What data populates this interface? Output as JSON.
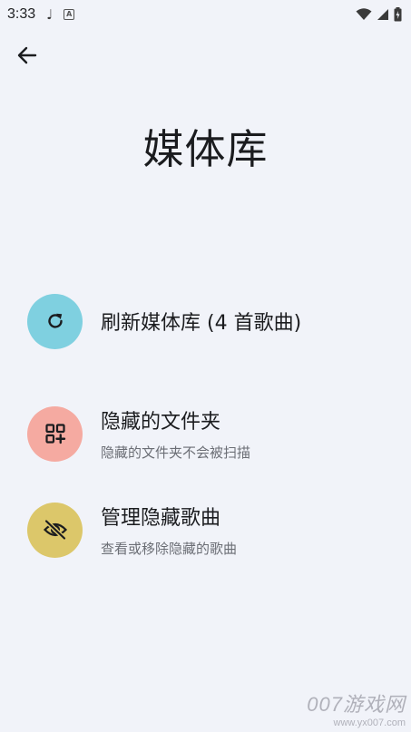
{
  "status_bar": {
    "time": "3:33",
    "note_glyph": "♩",
    "app_badge": "A"
  },
  "header": {
    "title": "媒体库"
  },
  "items": [
    {
      "title": "刷新媒体库 (4 首歌曲)",
      "subtitle": "",
      "icon": "refresh-icon",
      "color": "#7fd0e0"
    },
    {
      "title": "隐藏的文件夹",
      "subtitle": "隐藏的文件夹不会被扫描",
      "icon": "add-grid-icon",
      "color": "#f5aaa1"
    },
    {
      "title": "管理隐藏歌曲",
      "subtitle": "查看或移除隐藏的歌曲",
      "icon": "eye-off-icon",
      "color": "#dcc76a"
    }
  ],
  "watermark": {
    "line1": "007游戏网",
    "line2": "www.yx007.com"
  }
}
